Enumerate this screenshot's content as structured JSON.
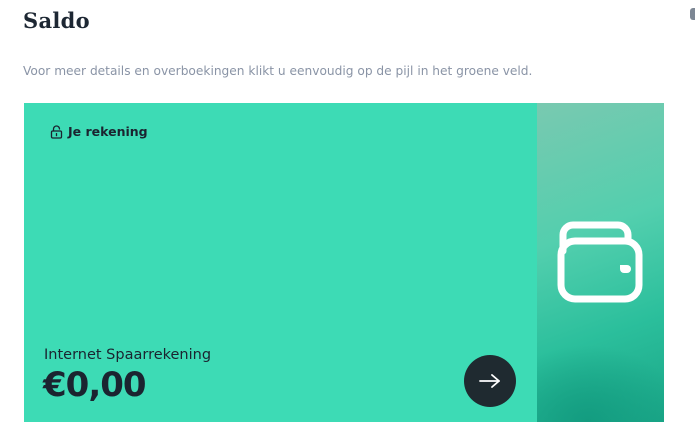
{
  "page": {
    "title": "Saldo",
    "subtitle": "Voor meer details en overboekingen klikt u eenvoudig op de pijl in het groene veld."
  },
  "account_card": {
    "label": "Je rekening",
    "label_icon": "lock-icon",
    "product_name": "Internet Spaarrekening",
    "balance": "€0,00",
    "action_icon": "arrow-right-icon",
    "illustration_icon": "wallet-icon",
    "colors": {
      "card_green": "#3ddbb5",
      "dark": "#1f2a30",
      "text": "#1b2430"
    }
  }
}
